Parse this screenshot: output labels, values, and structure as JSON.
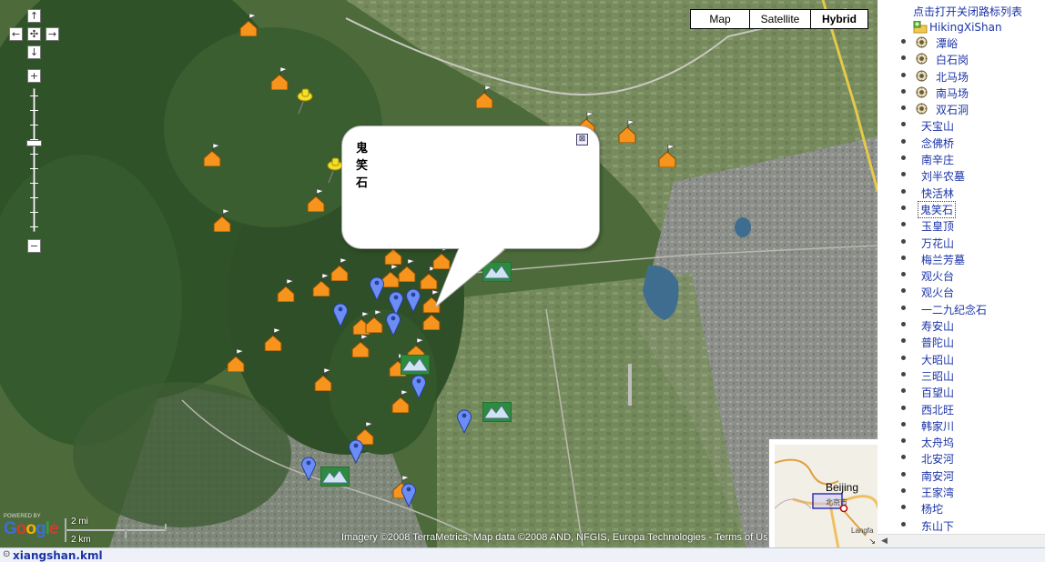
{
  "map": {
    "type_buttons": [
      {
        "label": "Map",
        "active": false
      },
      {
        "label": "Satellite",
        "active": false
      },
      {
        "label": "Hybrid",
        "active": true
      }
    ],
    "nav": {
      "up": "↑",
      "left": "←",
      "center": "✣",
      "right": "→",
      "down": "↓",
      "zoom_in": "+",
      "zoom_out": "−"
    },
    "info_window": {
      "title": "鬼笑石",
      "close": "⊠"
    },
    "copyright": "Imagery ©2008 TerraMetrics, Map data ©2008 AND, NFGIS, Europa Technologies - Terms of Use",
    "logo": {
      "powered": "POWERED BY",
      "word": "Google"
    },
    "scale": {
      "top": "2 mi",
      "bottom": "2 km"
    },
    "overview": {
      "city": "Beijing",
      "city_cn": "北京市",
      "other": "Langfa"
    },
    "colors": {
      "pin_orange": "#f7941d",
      "pin_blue": "#6b8ef5",
      "pushpin": "#f2e02a",
      "lake": "#3e6d8f"
    }
  },
  "sidebar": {
    "toggle_label": "点击打开关闭路标列表",
    "folder": "HikingXiShan",
    "items": [
      {
        "label": "潭峪",
        "gear": true
      },
      {
        "label": "白石岗",
        "gear": true
      },
      {
        "label": "北马场",
        "gear": true
      },
      {
        "label": "南马场",
        "gear": true
      },
      {
        "label": "双石洞",
        "gear": true
      },
      {
        "label": "天宝山",
        "gear": false
      },
      {
        "label": "念佛桥",
        "gear": false
      },
      {
        "label": "南辛庄",
        "gear": false
      },
      {
        "label": "刘半农墓",
        "gear": false
      },
      {
        "label": "快活林",
        "gear": false
      },
      {
        "label": "鬼笑石",
        "gear": false,
        "selected": true
      },
      {
        "label": "玉皇顶",
        "gear": false
      },
      {
        "label": "万花山",
        "gear": false
      },
      {
        "label": "梅兰芳墓",
        "gear": false
      },
      {
        "label": "观火台",
        "gear": false
      },
      {
        "label": "观火台",
        "gear": false
      },
      {
        "label": "一二九纪念石",
        "gear": false
      },
      {
        "label": "寿安山",
        "gear": false
      },
      {
        "label": "普陀山",
        "gear": false
      },
      {
        "label": "大昭山",
        "gear": false
      },
      {
        "label": "三昭山",
        "gear": false
      },
      {
        "label": "百望山",
        "gear": false
      },
      {
        "label": "西北旺",
        "gear": false
      },
      {
        "label": "韩家川",
        "gear": false
      },
      {
        "label": "太舟坞",
        "gear": false
      },
      {
        "label": "北安河",
        "gear": false
      },
      {
        "label": "南安河",
        "gear": false
      },
      {
        "label": "王家湾",
        "gear": false
      },
      {
        "label": "杨坨",
        "gear": false
      },
      {
        "label": "东山下",
        "gear": false
      }
    ]
  },
  "status": {
    "icon": "🖸",
    "file": "xiangshan.kml"
  }
}
